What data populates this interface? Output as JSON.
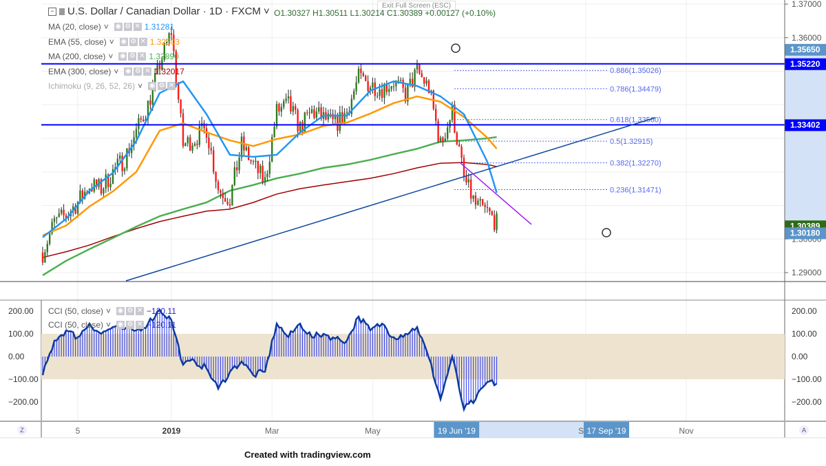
{
  "header": {
    "symbol_title": "U.S. Dollar / Canadian Dollar · 1D · FXCM",
    "ohlc": "O1.30327  H1.30511  L1.30214  C1.30389  +0.00127 (+0.10%)",
    "exit_fullscreen": "Exit Full Screen (ESC)"
  },
  "indicators": [
    {
      "label": "MA (20, close)",
      "value": "1.31281",
      "color": "#2196f3"
    },
    {
      "label": "EMA (55, close)",
      "value": "1.32503",
      "color": "#ff9800"
    },
    {
      "label": "MA (200, close)",
      "value": "1.32890",
      "color": "#4caf50"
    },
    {
      "label": "EMA (300, close)",
      "value": "1.32017",
      "color": "#a00000"
    },
    {
      "label": "Ichimoku (9, 26, 52, 26)",
      "value": "",
      "color": "#999"
    }
  ],
  "cci_legend": [
    {
      "label": "CCI (50, close)",
      "value": "−120.11"
    },
    {
      "label": "CCI (50, close)",
      "value": "−120.11"
    }
  ],
  "footer": "Created with tradingview.com",
  "corner_left": "Z",
  "corner_right": "A",
  "chart_data": {
    "type": "candlestick",
    "price_axis": {
      "ticks": [
        "1.37000",
        "1.36000",
        "1.35000",
        "1.34000",
        "1.33000",
        "1.32000",
        "1.31000",
        "1.30000",
        "1.29000"
      ],
      "range": [
        1.29,
        1.37
      ]
    },
    "price_labels": [
      {
        "text": "1.35650",
        "value": 1.3565,
        "color": "#5b95c9"
      },
      {
        "text": "1.35220",
        "value": 1.3522,
        "color": "#0000ff"
      },
      {
        "text": "1.33402",
        "value": 1.33402,
        "color": "#0000ff"
      },
      {
        "text": "1.30389",
        "value": 1.30389,
        "color": "#2e6b16"
      },
      {
        "text": "1.30180",
        "value": 1.3018,
        "color": "#5b95c9"
      }
    ],
    "horizontal_lines": [
      1.3522,
      1.33402
    ],
    "fib_levels": [
      {
        "text": "0.886(1.35026)",
        "value": 1.35026
      },
      {
        "text": "0.786(1.34479)",
        "value": 1.34479
      },
      {
        "text": "0.618(1.33560)",
        "value": 1.3356
      },
      {
        "text": "0.5(1.32915)",
        "value": 1.32915
      },
      {
        "text": "0.382(1.32270)",
        "value": 1.3227
      },
      {
        "text": "0.236(1.31471)",
        "value": 1.31471
      }
    ],
    "time_axis": [
      {
        "text": "5",
        "bar": 15
      },
      {
        "text": "2019",
        "bar": 55
      },
      {
        "text": "Mar",
        "bar": 98
      },
      {
        "text": "May",
        "bar": 141
      },
      {
        "text": "Sep",
        "bar": 232
      },
      {
        "text": "Nov",
        "bar": 275
      }
    ],
    "time_highlights": [
      {
        "text": "19 Jun '19",
        "bar": 176
      },
      {
        "text": "17 Sep '19",
        "bar": 240
      }
    ],
    "closes_every_5_bars": [
      1.296,
      1.305,
      1.307,
      1.311,
      1.316,
      1.315,
      1.32,
      1.324,
      1.332,
      1.34,
      1.352,
      1.362,
      1.328,
      1.33,
      1.333,
      1.315,
      1.312,
      1.328,
      1.322,
      1.317,
      1.338,
      1.34,
      1.333,
      1.338,
      1.336,
      1.334,
      1.338,
      1.348,
      1.346,
      1.345,
      1.347,
      1.343,
      1.35,
      1.345,
      1.328,
      1.338,
      1.318,
      1.31,
      1.308,
      1.3039
    ],
    "ma_every_10_bars": {
      "ma20": [
        1.3005,
        1.306,
        1.3144,
        1.3197,
        1.3292,
        1.3435,
        1.347,
        1.3372,
        1.3251,
        1.3245,
        1.3251,
        1.3318,
        1.3368,
        1.3368,
        1.3442,
        1.347,
        1.3456,
        1.3425,
        1.3372,
        1.323,
        1.3138
      ],
      "ema55": [
        1.3011,
        1.304,
        1.3097,
        1.3142,
        1.32,
        1.3323,
        1.3345,
        1.3318,
        1.3294,
        1.3277,
        1.3298,
        1.3312,
        1.3337,
        1.3347,
        1.3374,
        1.3405,
        1.3425,
        1.3409,
        1.3364,
        1.3302,
        1.3269
      ],
      "ma200": [
        1.2892,
        1.2935,
        1.297,
        1.3003,
        1.3037,
        1.3068,
        1.3089,
        1.3109,
        1.3144,
        1.3161,
        1.3181,
        1.3195,
        1.3212,
        1.3222,
        1.3236,
        1.3253,
        1.3269,
        1.329,
        1.3294,
        1.33,
        1.3304
      ],
      "ema300": [
        1.2945,
        1.2962,
        1.2982,
        1.3007,
        1.3031,
        1.3052,
        1.3068,
        1.3083,
        1.3089,
        1.3109,
        1.3134,
        1.315,
        1.3161,
        1.3171,
        1.3181,
        1.3195,
        1.3212,
        1.3226,
        1.3228,
        1.3222,
        1.3216
      ]
    },
    "cci_axis": {
      "ticks": [
        "200.00",
        "100.00",
        "0.00",
        "−100.00",
        "−200.00"
      ],
      "range": [
        -200,
        200
      ]
    },
    "cci_every_5_bars": [
      -82,
      70,
      115,
      85,
      145,
      100,
      130,
      121,
      115,
      145,
      206,
      160,
      -36,
      -21,
      -52,
      -142,
      -67,
      -21,
      -82,
      -67,
      145,
      85,
      145,
      85,
      100,
      79,
      70,
      176,
      115,
      145,
      85,
      100,
      130,
      -6,
      -188,
      0,
      -233,
      -188,
      -112,
      -120
    ]
  }
}
